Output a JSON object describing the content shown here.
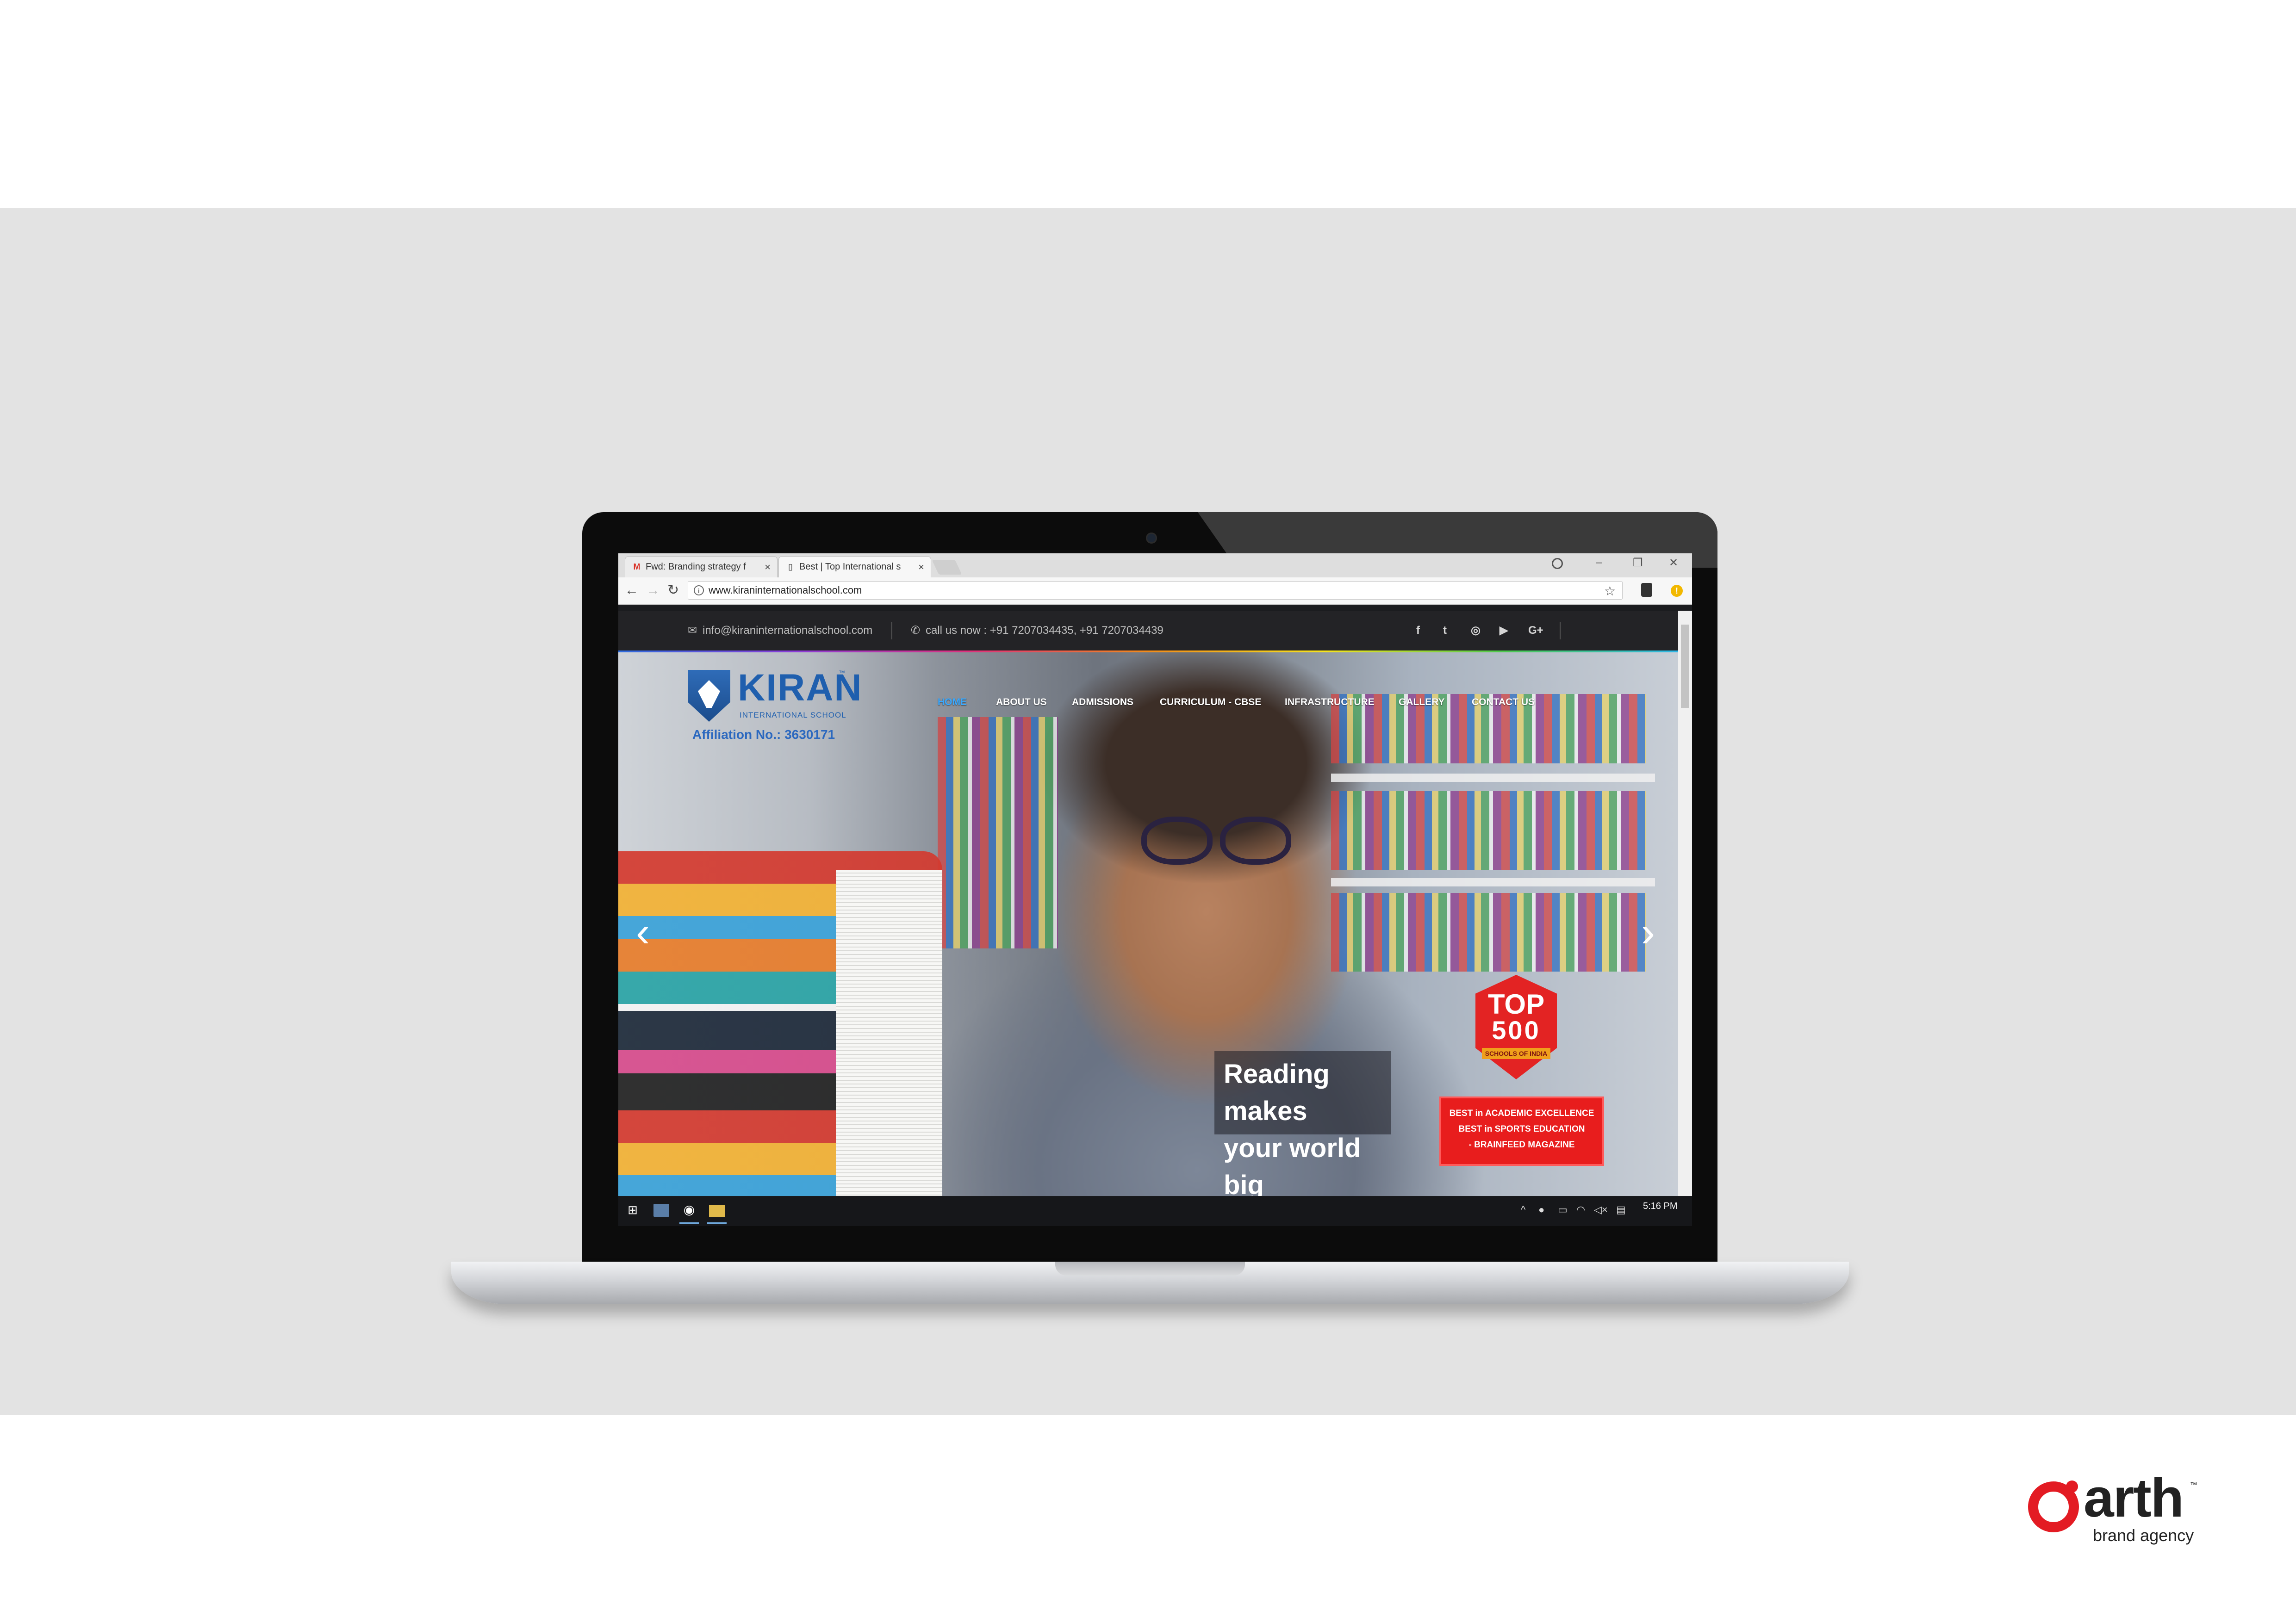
{
  "browser": {
    "tabs": [
      {
        "icon": "M",
        "title": "Fwd: Branding strategy f"
      },
      {
        "icon": "▯",
        "title": "Best | Top International s"
      }
    ],
    "url": "www.kiraninternationalschool.com"
  },
  "site": {
    "topbar": {
      "email": "info@kiraninternationalschool.com",
      "phone": "call us now : +91 7207034435, +91 7207034439",
      "social": [
        "f",
        "t",
        "◎",
        "▶",
        "G+"
      ]
    },
    "logo": {
      "name": "KIRAN",
      "tm": "™",
      "sub": "INTERNATIONAL SCHOOL",
      "affiliation": "Affiliation No.: 3630171"
    },
    "nav": [
      "HOME",
      "ABOUT US",
      "ADMISSIONS",
      "CURRICULUM - CBSE",
      "INFRASTRUCTURE",
      "GALLERY",
      "CONTACT US"
    ],
    "caption": "Reading makes\nyour world big",
    "badge": {
      "top": "TOP",
      "number": "500",
      "ribbon": "SCHOOLS OF INDIA"
    },
    "award": [
      "BEST in ACADEMIC EXCELLENCE",
      "BEST in SPORTS EDUCATION",
      "- BRAINFEED MAGAZINE"
    ]
  },
  "taskbar": {
    "time": "5:16 PM"
  },
  "brand": {
    "name": "arth",
    "tm": "™",
    "sub": "brand agency"
  },
  "colors": {
    "accent_red": "#e31b23",
    "nav_active": "#3aa9ff",
    "logo_blue": "#1f5fae"
  }
}
